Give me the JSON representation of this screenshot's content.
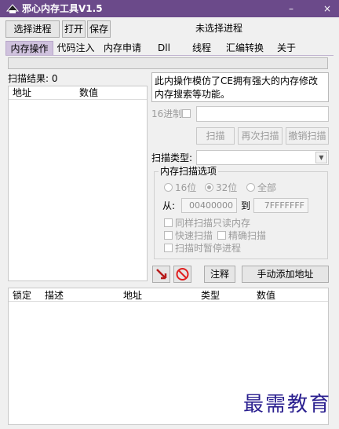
{
  "window": {
    "title": "邪心内存工具V1.5",
    "minimize": "–",
    "close": "×"
  },
  "toolbar": {
    "select_process": "选择进程",
    "open": "打开",
    "save": "保存",
    "process_status": "未选择进程"
  },
  "tabs": [
    "内存操作",
    "代码注入",
    "内存申请",
    "Dll",
    "线程",
    "汇编转换",
    "关于"
  ],
  "scan_results": {
    "label": "扫描结果: 0",
    "col_address": "地址",
    "col_value": "数值"
  },
  "info_text": "此内操作模仿了CE拥有强大的内存修改内存搜索等功能。",
  "hex": {
    "label": "16进制"
  },
  "scan_buttons": {
    "scan": "扫描",
    "rescan": "再次扫描",
    "undo": "撤销扫描"
  },
  "scan_type": {
    "label": "扫描类型:",
    "value": ""
  },
  "options": {
    "title": "内存扫描选项",
    "bits16": "16位",
    "bits32": "32位",
    "all": "全部",
    "from_label": "从:",
    "from_value": "00400000",
    "to_label": "到",
    "to_value": "7FFFFFFF",
    "readonly": "同样扫描只读内存",
    "fast": "快速扫描",
    "precise": "精确扫描",
    "pause": "扫描时暂停进程"
  },
  "actions": {
    "comment": "注释",
    "add_address": "手动添加地址"
  },
  "address_list": {
    "col_lock": "锁定",
    "col_desc": "描述",
    "col_address": "地址",
    "col_type": "类型",
    "col_value": "数值"
  },
  "watermark": "最需教育"
}
